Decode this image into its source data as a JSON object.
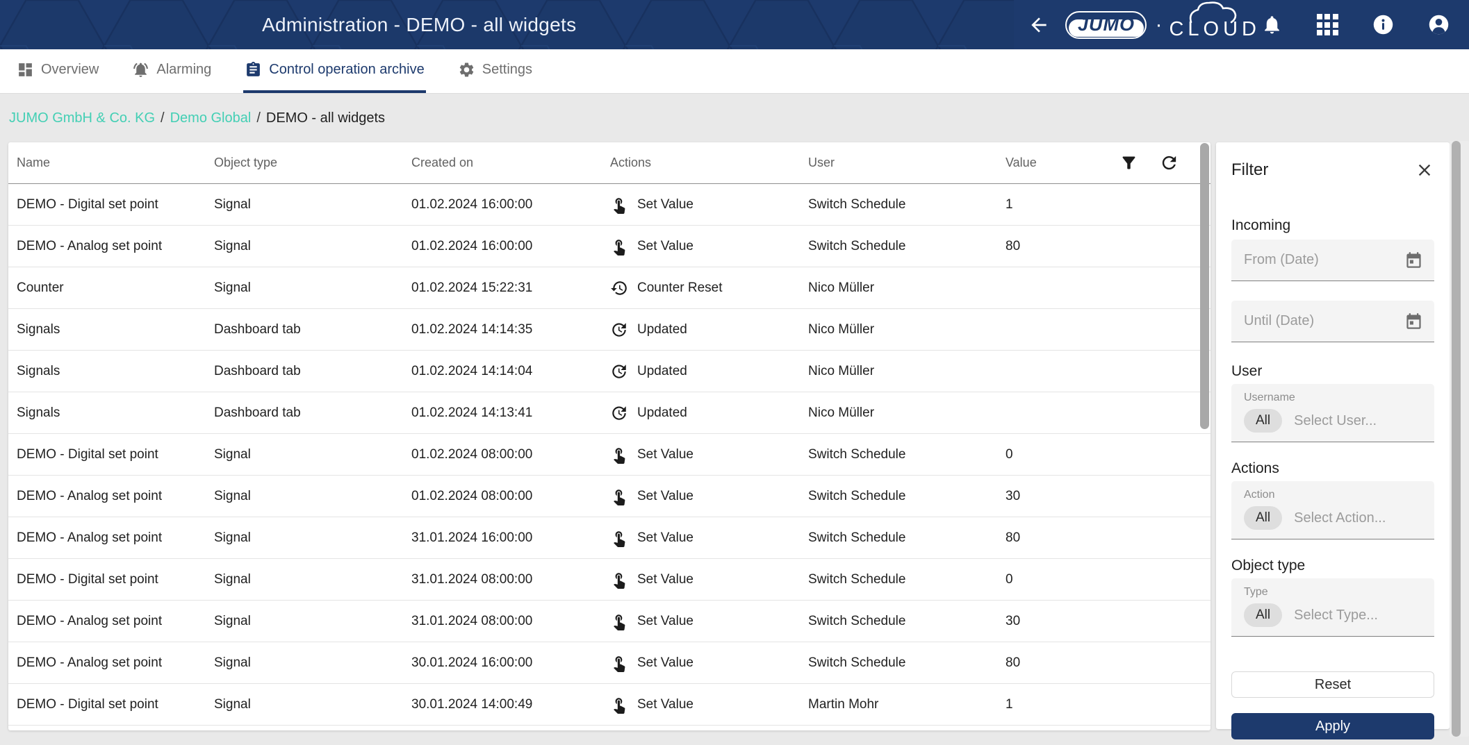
{
  "colors": {
    "navy": "#1d3a6d",
    "teal": "#43cfb4",
    "page_bg": "#e9e9e9"
  },
  "header": {
    "title": "Administration - DEMO - all widgets",
    "logo": {
      "brand": "JUMO",
      "separator": "·",
      "product": "CLOUD"
    },
    "icons": {
      "back": "arrow-left",
      "notifications": "bell",
      "apps": "grid-3x3",
      "info": "info-circle",
      "account": "person-circle"
    }
  },
  "tabs": [
    {
      "label": "Overview",
      "icon": "dashboard-icon",
      "active": false
    },
    {
      "label": "Alarming",
      "icon": "alarm-bell-icon",
      "active": false
    },
    {
      "label": "Control operation archive",
      "icon": "clipboard-icon",
      "active": true
    },
    {
      "label": "Settings",
      "icon": "gear-icon",
      "active": false
    }
  ],
  "breadcrumb": {
    "separator": "/",
    "items": [
      {
        "label": "JUMO GmbH & Co. KG",
        "link": true
      },
      {
        "label": "Demo Global",
        "link": true
      },
      {
        "label": "DEMO - all widgets",
        "link": false
      }
    ]
  },
  "table": {
    "columns": [
      "Name",
      "Object type",
      "Created on",
      "Actions",
      "User",
      "Value"
    ],
    "tools": {
      "filter": "filter-icon",
      "refresh": "refresh-icon"
    },
    "rows": [
      {
        "name": "DEMO - Digital set point",
        "object_type": "Signal",
        "created_on": "01.02.2024 16:00:00",
        "action_label": "Set Value",
        "action_icon": "touch-app-icon",
        "user": "Switch Schedule",
        "value": "1"
      },
      {
        "name": "DEMO - Analog set point",
        "object_type": "Signal",
        "created_on": "01.02.2024 16:00:00",
        "action_label": "Set Value",
        "action_icon": "touch-app-icon",
        "user": "Switch Schedule",
        "value": "80"
      },
      {
        "name": "Counter",
        "object_type": "Signal",
        "created_on": "01.02.2024 15:22:31",
        "action_label": "Counter Reset",
        "action_icon": "restore-icon",
        "user": "Nico Müller",
        "value": ""
      },
      {
        "name": "Signals",
        "object_type": "Dashboard tab",
        "created_on": "01.02.2024 14:14:35",
        "action_label": "Updated",
        "action_icon": "update-icon",
        "user": "Nico Müller",
        "value": ""
      },
      {
        "name": "Signals",
        "object_type": "Dashboard tab",
        "created_on": "01.02.2024 14:14:04",
        "action_label": "Updated",
        "action_icon": "update-icon",
        "user": "Nico Müller",
        "value": ""
      },
      {
        "name": "Signals",
        "object_type": "Dashboard tab",
        "created_on": "01.02.2024 14:13:41",
        "action_label": "Updated",
        "action_icon": "update-icon",
        "user": "Nico Müller",
        "value": ""
      },
      {
        "name": "DEMO - Digital set point",
        "object_type": "Signal",
        "created_on": "01.02.2024 08:00:00",
        "action_label": "Set Value",
        "action_icon": "touch-app-icon",
        "user": "Switch Schedule",
        "value": "0"
      },
      {
        "name": "DEMO - Analog set point",
        "object_type": "Signal",
        "created_on": "01.02.2024 08:00:00",
        "action_label": "Set Value",
        "action_icon": "touch-app-icon",
        "user": "Switch Schedule",
        "value": "30"
      },
      {
        "name": "DEMO - Analog set point",
        "object_type": "Signal",
        "created_on": "31.01.2024 16:00:00",
        "action_label": "Set Value",
        "action_icon": "touch-app-icon",
        "user": "Switch Schedule",
        "value": "80"
      },
      {
        "name": "DEMO - Digital set point",
        "object_type": "Signal",
        "created_on": "31.01.2024 08:00:00",
        "action_label": "Set Value",
        "action_icon": "touch-app-icon",
        "user": "Switch Schedule",
        "value": "0"
      },
      {
        "name": "DEMO - Analog set point",
        "object_type": "Signal",
        "created_on": "31.01.2024 08:00:00",
        "action_label": "Set Value",
        "action_icon": "touch-app-icon",
        "user": "Switch Schedule",
        "value": "30"
      },
      {
        "name": "DEMO - Analog set point",
        "object_type": "Signal",
        "created_on": "30.01.2024 16:00:00",
        "action_label": "Set Value",
        "action_icon": "touch-app-icon",
        "user": "Switch Schedule",
        "value": "80"
      },
      {
        "name": "DEMO - Digital set point",
        "object_type": "Signal",
        "created_on": "30.01.2024 14:00:49",
        "action_label": "Set Value",
        "action_icon": "touch-app-icon",
        "user": "Martin Mohr",
        "value": "1"
      }
    ]
  },
  "filter": {
    "title": "Filter",
    "incoming": {
      "heading": "Incoming",
      "from_placeholder": "From (Date)",
      "until_placeholder": "Until (Date)"
    },
    "user": {
      "heading": "User",
      "field_label": "Username",
      "chip": "All",
      "placeholder": "Select User..."
    },
    "actions": {
      "heading": "Actions",
      "field_label": "Action",
      "chip": "All",
      "placeholder": "Select Action..."
    },
    "object_type": {
      "heading": "Object type",
      "field_label": "Type",
      "chip": "All",
      "placeholder": "Select Type..."
    },
    "reset_label": "Reset",
    "apply_label": "Apply"
  }
}
